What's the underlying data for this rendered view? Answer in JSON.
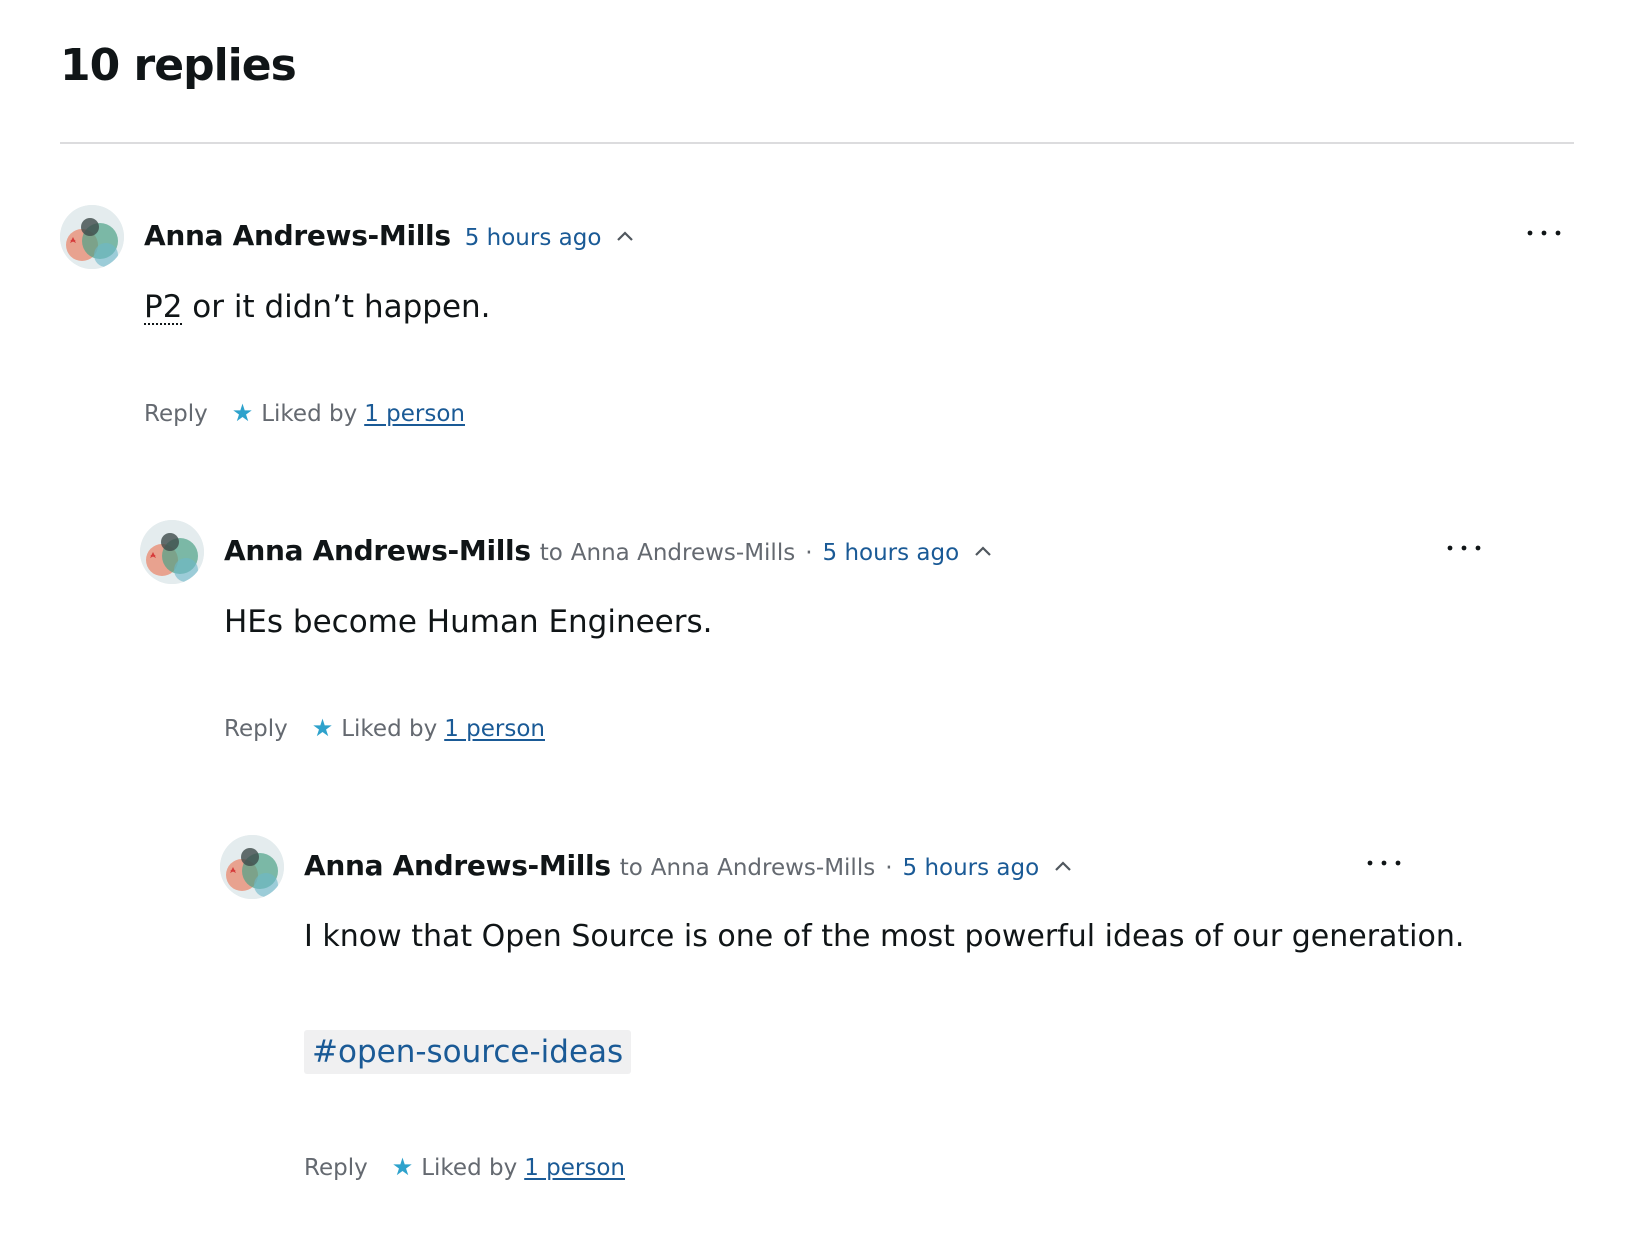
{
  "header": {
    "title": "10 replies"
  },
  "comments": [
    {
      "author": "Anna Andrews-Mills",
      "to_prefix": "",
      "to_name": "",
      "time": "5 hours ago",
      "body_abbr": "P2",
      "body_rest": " or it didn’t happen.",
      "reply_label": "Reply",
      "liked_prefix": "Liked by",
      "liked_link": "1 person"
    },
    {
      "author": "Anna Andrews-Mills",
      "to_prefix": "to",
      "to_name": "Anna Andrews-Mills",
      "time": "5 hours ago",
      "body": "HEs become Human Engineers.",
      "reply_label": "Reply",
      "liked_prefix": "Liked by",
      "liked_link": "1 person"
    },
    {
      "author": "Anna Andrews-Mills",
      "to_prefix": "to",
      "to_name": "Anna Andrews-Mills",
      "time": "5 hours ago",
      "body": "I know that Open Source is one of the most powerful ideas of our generation.",
      "tag": "#open-source-ideas",
      "reply_label": "Reply",
      "liked_prefix": "Liked by",
      "liked_link": "1 person"
    }
  ],
  "icons": {
    "collapse": "chevron-up-icon",
    "more": "ellipsis-icon",
    "like": "star-icon"
  },
  "colors": {
    "link": "#1a5a96",
    "star": "#2ea2cc",
    "muted": "#646970",
    "text": "#101517"
  }
}
